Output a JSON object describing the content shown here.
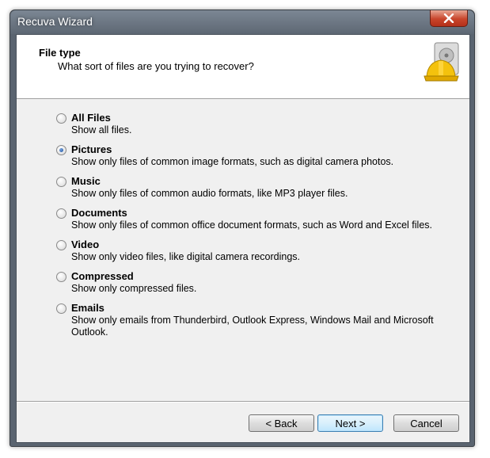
{
  "window": {
    "title": "Recuva Wizard"
  },
  "header": {
    "title": "File type",
    "subtitle": "What sort of files are you trying to recover?",
    "icon": "hard-drive-helmet-icon"
  },
  "options": [
    {
      "label": "All Files",
      "description": "Show all files.",
      "selected": false
    },
    {
      "label": "Pictures",
      "description": "Show only files of common image formats, such as digital camera photos.",
      "selected": true
    },
    {
      "label": "Music",
      "description": "Show only files of common audio formats, like MP3 player files.",
      "selected": false
    },
    {
      "label": "Documents",
      "description": "Show only files of common office document formats, such as Word and Excel files.",
      "selected": false
    },
    {
      "label": "Video",
      "description": "Show only video files, like digital camera recordings.",
      "selected": false
    },
    {
      "label": "Compressed",
      "description": "Show only compressed files.",
      "selected": false
    },
    {
      "label": "Emails",
      "description": "Show only emails from Thunderbird, Outlook Express, Windows Mail and Microsoft Outlook.",
      "selected": false
    }
  ],
  "buttons": {
    "back": "< Back",
    "next": "Next >",
    "cancel": "Cancel"
  },
  "colors": {
    "close_button": "#c8452b",
    "selected_radio": "#1b4f9b"
  }
}
